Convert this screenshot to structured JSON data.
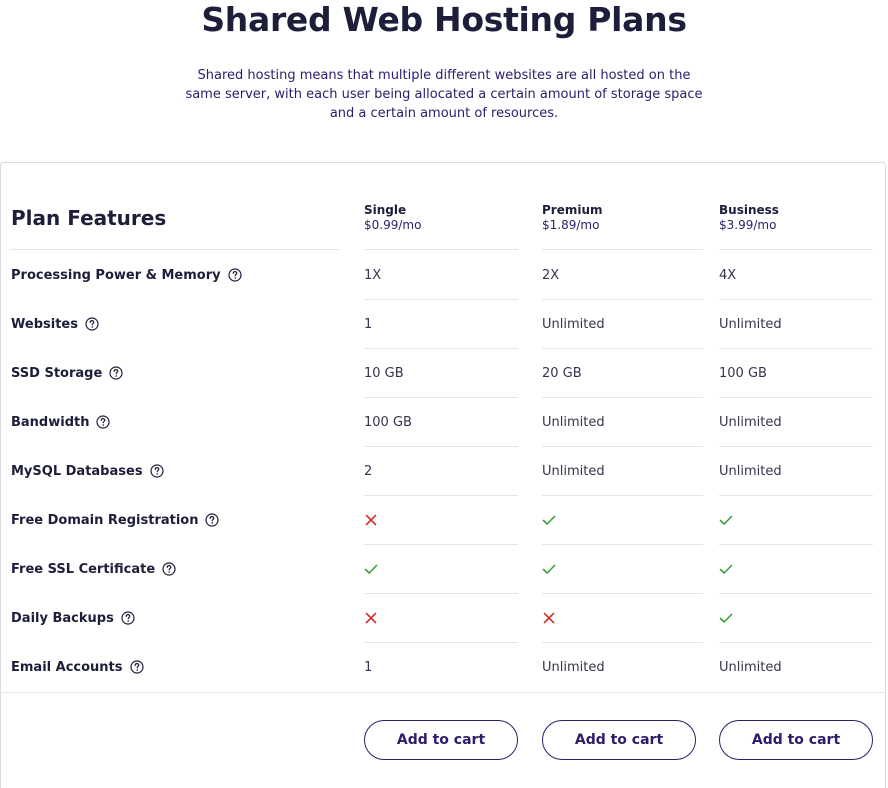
{
  "header": {
    "title": "Shared Web Hosting Plans",
    "subtitle": "Shared hosting means that multiple different websites are all hosted on the same server, with each user being allocated a certain amount of storage space and a certain amount of resources."
  },
  "table": {
    "features_heading": "Plan Features",
    "plans": [
      {
        "name": "Single",
        "price": "$0.99/mo"
      },
      {
        "name": "Premium",
        "price": "$1.89/mo"
      },
      {
        "name": "Business",
        "price": "$3.99/mo"
      }
    ],
    "rows": [
      {
        "label": "Processing Power & Memory",
        "values": [
          "1X",
          "2X",
          "4X"
        ]
      },
      {
        "label": "Websites",
        "values": [
          "1",
          "Unlimited",
          "Unlimited"
        ]
      },
      {
        "label": "SSD Storage",
        "values": [
          "10 GB",
          "20 GB",
          "100 GB"
        ]
      },
      {
        "label": "Bandwidth",
        "values": [
          "100 GB",
          "Unlimited",
          "Unlimited"
        ]
      },
      {
        "label": "MySQL Databases",
        "values": [
          "2",
          "Unlimited",
          "Unlimited"
        ]
      },
      {
        "label": "Free Domain Registration",
        "marks": [
          "cross-icon",
          "check-icon",
          "check-icon"
        ]
      },
      {
        "label": "Free SSL Certificate",
        "marks": [
          "check-icon",
          "check-icon",
          "check-icon"
        ]
      },
      {
        "label": "Daily Backups",
        "marks": [
          "cross-icon",
          "cross-icon",
          "check-icon"
        ]
      },
      {
        "label": "Email Accounts",
        "values": [
          "1",
          "Unlimited",
          "Unlimited"
        ]
      }
    ],
    "cart_label": "Add to cart"
  },
  "colors": {
    "check": "#3a9f3a",
    "cross": "#d63230",
    "button_border": "#2f1c6a"
  }
}
